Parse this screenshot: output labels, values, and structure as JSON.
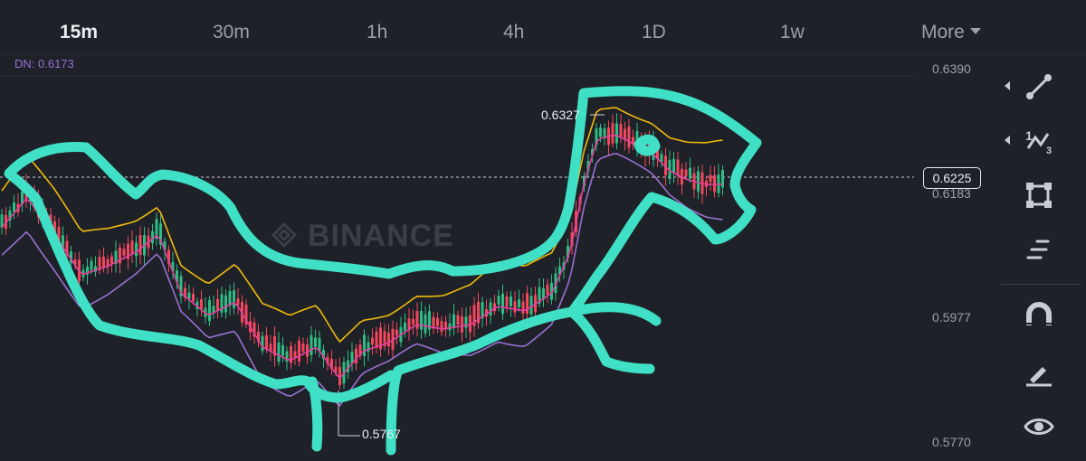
{
  "timeframes": [
    "15m",
    "30m",
    "1h",
    "4h",
    "1D",
    "1w"
  ],
  "active_timeframe": "15m",
  "more_label": "More",
  "indicator_label": "DN: 0.6173",
  "watermark": "BINANCE",
  "price_axis": [
    "0.6390",
    "0.6183",
    "0.5977",
    "0.5770"
  ],
  "current_price": "0.6225",
  "high_label": "0.6327",
  "low_label": "0.5767",
  "colors": {
    "up": "#2ebd85",
    "down": "#f6465d",
    "upper_band": "#f0b90b",
    "middle_band": "#e040a0",
    "lower_band": "#9b6fd4",
    "annotation": "#3fe0c5"
  },
  "tools": [
    "line-tool-icon",
    "multi-line-tool-icon",
    "shape-tool-icon",
    "text-tool-icon",
    "magnet-icon",
    "pencil-icon",
    "eye-icon"
  ]
}
